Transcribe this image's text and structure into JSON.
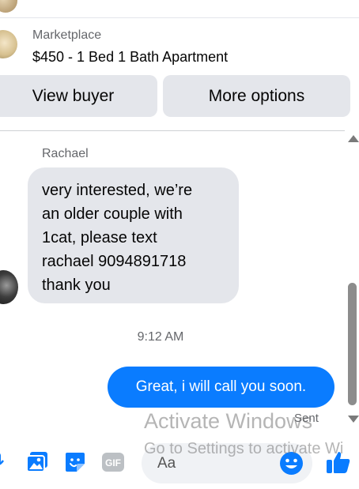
{
  "marketplace": {
    "label": "Marketplace",
    "listing_title": "$450 - 1 Bed 1 Bath Apartment",
    "view_buyer_label": "View buyer",
    "more_options_label": "More options"
  },
  "conversation": {
    "sender_name": "Rachael",
    "incoming_lines": [
      "very interested, we’re",
      "an older couple with",
      "1cat, please text",
      "rachael 9094891718",
      "thank you"
    ],
    "timestamp": "9:12 AM",
    "outgoing_message": "Great, i will call you soon.",
    "status": "Sent"
  },
  "composer": {
    "placeholder": "Aa",
    "gif_label": "GIF"
  },
  "watermark": {
    "line1": "Activate Windows",
    "line2": "Go to Settings to activate Wi"
  },
  "colors": {
    "accent": "#0a7cff",
    "bubble_gray": "#e4e6eb"
  },
  "icons": [
    "microphone-icon",
    "photo-icon",
    "sticker-icon",
    "gif-icon",
    "emoji-icon",
    "like-icon",
    "scroll-up-icon",
    "scroll-down-icon"
  ]
}
